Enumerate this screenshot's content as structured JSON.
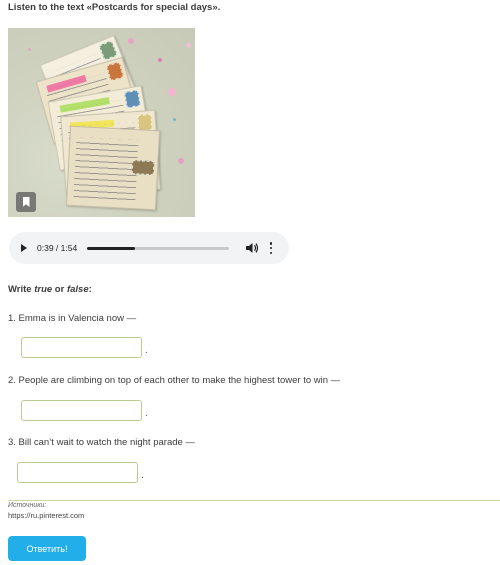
{
  "title": "Listen to the text «Postcards for special days».",
  "audio": {
    "time": "0:39 / 1:54",
    "progress": 0.34
  },
  "instruction": {
    "prefix": "Write ",
    "true_word": "true",
    "middle": " or ",
    "false_word": "false",
    "suffix": ":"
  },
  "questions": [
    {
      "text": "1. Emma is in Valencia now —",
      "answer": "",
      "end": "."
    },
    {
      "text": "2. People are climbing on top of each other to make the highest tower to win —",
      "answer": "",
      "end": "."
    },
    {
      "text": "3. Bill can’t wait to watch the night parade —",
      "answer": "",
      "end": "."
    }
  ],
  "sources": {
    "label": "Источники:",
    "url": "https://ru.pinterest.com"
  },
  "submit_label": "Ответить!",
  "colors": {
    "accent": "#22aee8",
    "input_border": "#b8cc8e",
    "divider": "#c7d89f"
  },
  "icons": [
    "bookmark-icon",
    "play-icon",
    "volume-icon",
    "more-vertical-icon"
  ]
}
